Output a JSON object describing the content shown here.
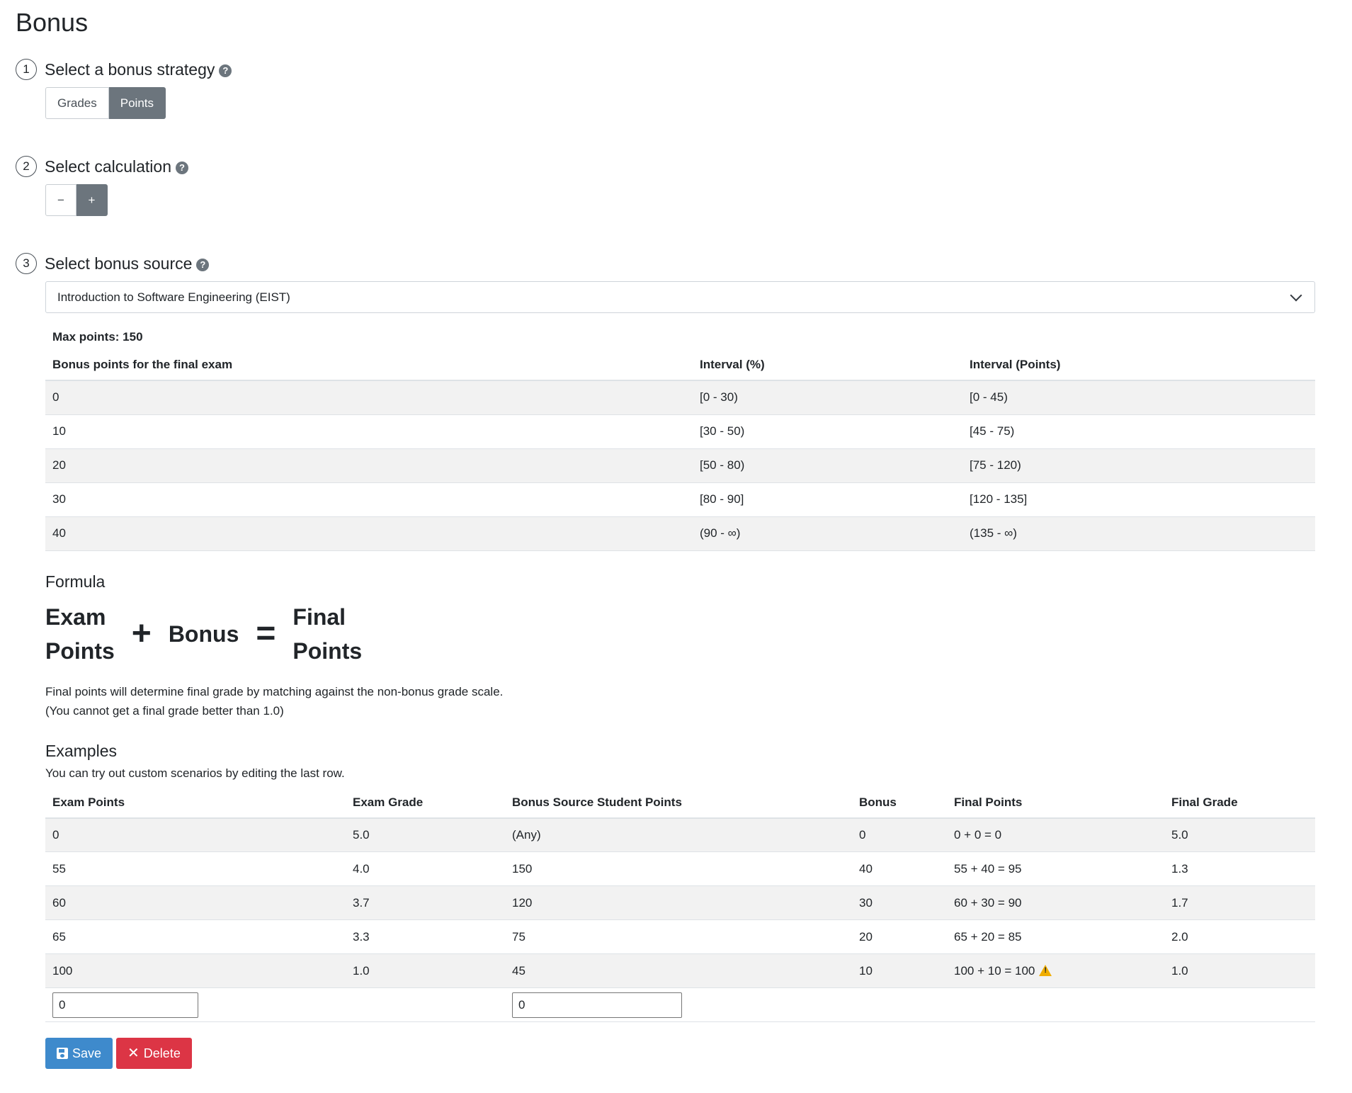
{
  "page": {
    "title": "Bonus"
  },
  "steps": [
    {
      "number": "1",
      "title": "Select a bonus strategy",
      "help": "?"
    },
    {
      "number": "2",
      "title": "Select calculation",
      "help": "?"
    },
    {
      "number": "3",
      "title": "Select bonus source",
      "help": "?"
    }
  ],
  "strategy": {
    "options": [
      "Grades",
      "Points"
    ],
    "selected": "Points"
  },
  "calculation": {
    "options": [
      "−",
      "+"
    ],
    "selected": "+"
  },
  "bonus_source": {
    "selected": "Introduction to Software Engineering (EIST)"
  },
  "bonus_table": {
    "max_points": "Max points: 150",
    "headers": [
      "Bonus points for the final exam",
      "Interval (%)",
      "Interval (Points)"
    ],
    "rows": [
      [
        "0",
        "[0 - 30)",
        "[0 - 45)"
      ],
      [
        "10",
        "[30 - 50)",
        "[45 - 75)"
      ],
      [
        "20",
        "[50 - 80)",
        "[75 - 120)"
      ],
      [
        "30",
        "[80 - 90]",
        "[120 - 135]"
      ],
      [
        "40",
        "(90 - ∞)",
        "(135 - ∞)"
      ]
    ]
  },
  "formula": {
    "title": "Formula",
    "term1_line1": "Exam",
    "term1_line2": "Points",
    "op1": "+",
    "term2": "Bonus",
    "op2": "=",
    "term3_line1": "Final",
    "term3_line2": "Points",
    "note1": "Final points will determine final grade by matching against the non-bonus grade scale.",
    "note2": "(You cannot get a final grade better than 1.0)"
  },
  "examples": {
    "title": "Examples",
    "description": "You can try out custom scenarios by editing the last row.",
    "headers": [
      "Exam Points",
      "Exam Grade",
      "Bonus Source Student Points",
      "Bonus",
      "Final Points",
      "Final Grade"
    ],
    "rows": [
      [
        "0",
        "5.0",
        "(Any)",
        "0",
        "0 + 0 = 0",
        "5.0"
      ],
      [
        "55",
        "4.0",
        "150",
        "40",
        "55 + 40 = 95",
        "1.3"
      ],
      [
        "60",
        "3.7",
        "120",
        "30",
        "60 + 30 = 90",
        "1.7"
      ],
      [
        "65",
        "3.3",
        "75",
        "20",
        "65 + 20 = 85",
        "2.0"
      ],
      [
        "100",
        "1.0",
        "45",
        "10",
        "100 + 10 = 100",
        "1.0"
      ]
    ],
    "warning_row_index": 4,
    "custom_exam_points": "0",
    "custom_source_points": "0"
  },
  "actions": {
    "save": "Save",
    "delete": "Delete"
  },
  "colors": {
    "primary": "#3e8acc",
    "danger": "#dc3545",
    "active_segment": "#6c757d",
    "warning": "#f0ad00"
  }
}
